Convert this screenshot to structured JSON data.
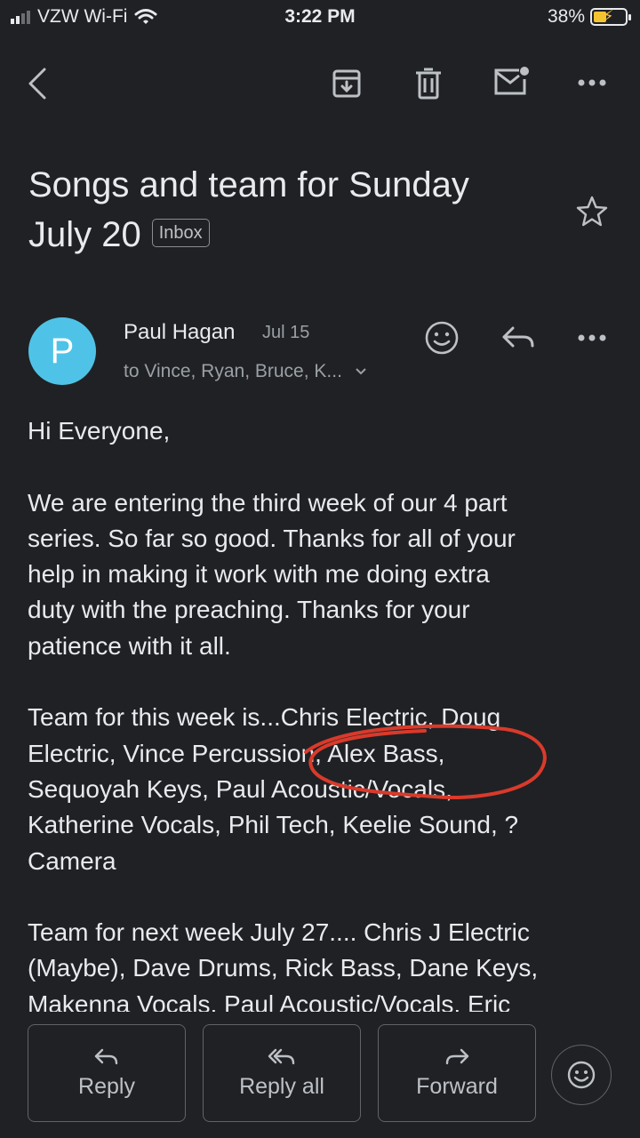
{
  "status_bar": {
    "carrier": "VZW Wi-Fi",
    "time": "3:22 PM",
    "battery_percent": "38%",
    "battery_level": 0.38
  },
  "toolbar": {
    "icons": [
      "back-icon",
      "archive-icon",
      "trash-icon",
      "mark-unread-icon",
      "more-icon"
    ]
  },
  "email": {
    "subject_line1": "Songs and team for Sunday",
    "subject_line2": "July 20",
    "label": "Inbox",
    "sender_initial": "P",
    "sender": "Paul Hagan",
    "date": "Jul 15",
    "recipients": "to Vince, Ryan, Bruce, K...",
    "avatar_color": "#4fc3e7",
    "body": {
      "greeting": "Hi Everyone,",
      "paragraph1_lines": [
        "We are entering the third week of our 4 part",
        "series.  So far so good.  Thanks for all of your",
        "help in making it work with me doing extra",
        "duty with the preaching.  Thanks for your",
        "patience with it all."
      ],
      "paragraph2_lines": [
        "Team for this week is...Chris Electric, Doug",
        "Electric, Vince Percussion, Alex Bass,",
        "Sequoyah Keys, Paul Acoustic/Vocals,",
        "Katherine Vocals, Phil Tech, Keelie Sound, ?",
        "Camera"
      ],
      "paragraph3_lines": [
        "Team for next week July 27.... Chris J Electric",
        "(Maybe), Dave Drums, Rick Bass, Dane Keys,",
        "Makenna Vocals, Paul Acoustic/Vocals,  Eric"
      ]
    }
  },
  "actions": {
    "reply": "Reply",
    "reply_all": "Reply all",
    "forward": "Forward"
  },
  "colors": {
    "background": "#202124",
    "annotation": "#d93a2b"
  }
}
